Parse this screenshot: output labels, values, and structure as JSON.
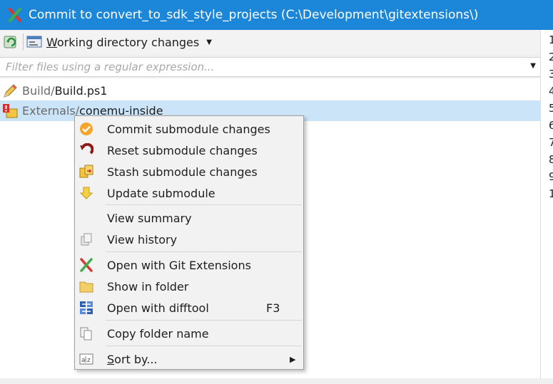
{
  "window": {
    "title": "Commit to convert_to_sdk_style_projects (C:\\Development\\gitextensions\\)"
  },
  "toolbar": {
    "mode_label_accel": "W",
    "mode_label_rest": "orking directory changes"
  },
  "filter": {
    "placeholder": "Filter files using a regular expression..."
  },
  "files": [
    {
      "dir": "Build/",
      "name": "Build.ps1",
      "icon": "pencil-icon",
      "selected": false
    },
    {
      "dir": "Externals/",
      "name": "conemu-inside",
      "icon": "submodule-icon",
      "selected": true
    }
  ],
  "line_numbers": [
    "1",
    "2",
    "3",
    "4",
    "5",
    "6",
    "7",
    "8",
    "9",
    "1"
  ],
  "context_menu": {
    "items": [
      {
        "label": "Commit submodule changes",
        "icon": "check-circle-icon"
      },
      {
        "label": "Reset submodule changes",
        "icon": "reset-icon"
      },
      {
        "label": "Stash submodule changes",
        "icon": "stash-icon"
      },
      {
        "label": "Update submodule",
        "icon": "down-arrow-icon"
      },
      {
        "label": "View summary",
        "icon": ""
      },
      {
        "label": "View history",
        "icon": "history-icon"
      },
      {
        "label": "Open with Git Extensions",
        "icon": "git-extensions-icon"
      },
      {
        "label": "Show in folder",
        "icon": "folder-icon"
      },
      {
        "label": "Open with difftool",
        "icon": "difftool-icon",
        "shortcut": "F3"
      },
      {
        "label": "Copy folder name",
        "icon": "copy-icon"
      },
      {
        "label_accel": "S",
        "label_rest": "ort by...",
        "icon": "sort-icon"
      }
    ]
  },
  "colors": {
    "titlebar": "#1c86d8",
    "selection": "#cce4f7",
    "menu_bg": "#f2f2f2"
  }
}
